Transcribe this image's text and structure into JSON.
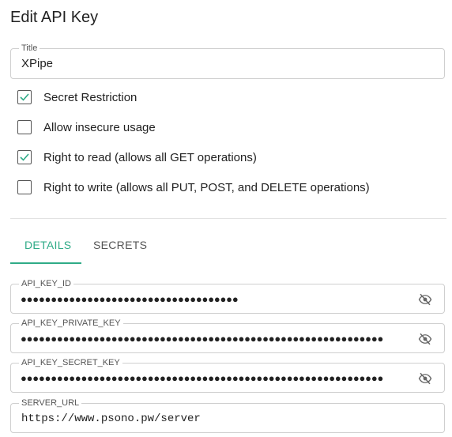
{
  "dialog": {
    "title": "Edit API Key"
  },
  "title_field": {
    "label": "Title",
    "value": "XPipe"
  },
  "options": [
    {
      "label": "Secret Restriction",
      "checked": true
    },
    {
      "label": "Allow insecure usage",
      "checked": false
    },
    {
      "label": "Right to read (allows all GET operations)",
      "checked": true
    },
    {
      "label": "Right to write (allows all PUT, POST, and DELETE operations)",
      "checked": false
    }
  ],
  "tabs": [
    {
      "label": "DETAILS",
      "active": true
    },
    {
      "label": "SECRETS",
      "active": false
    }
  ],
  "fields": {
    "api_key_id": {
      "label": "API_KEY_ID",
      "value": "●●●●●●●●●●●●●●●●●●●●●●●●●●●●●●●●●●●●"
    },
    "api_key_private_key": {
      "label": "API_KEY_PRIVATE_KEY",
      "value": "●●●●●●●●●●●●●●●●●●●●●●●●●●●●●●●●●●●●●●●●●●●●●●●●●●●●●●●●●●●●"
    },
    "api_key_secret_key": {
      "label": "API_KEY_SECRET_KEY",
      "value": "●●●●●●●●●●●●●●●●●●●●●●●●●●●●●●●●●●●●●●●●●●●●●●●●●●●●●●●●●●●●"
    },
    "server_url": {
      "label": "SERVER_URL",
      "value": "https://www.psono.pw/server"
    }
  },
  "colors": {
    "accent": "#2fab87",
    "border": "#cfcfcf",
    "text": "#222222"
  },
  "icons": {
    "visibility_toggle": "eye-off-icon",
    "checkmark": "check-icon"
  }
}
